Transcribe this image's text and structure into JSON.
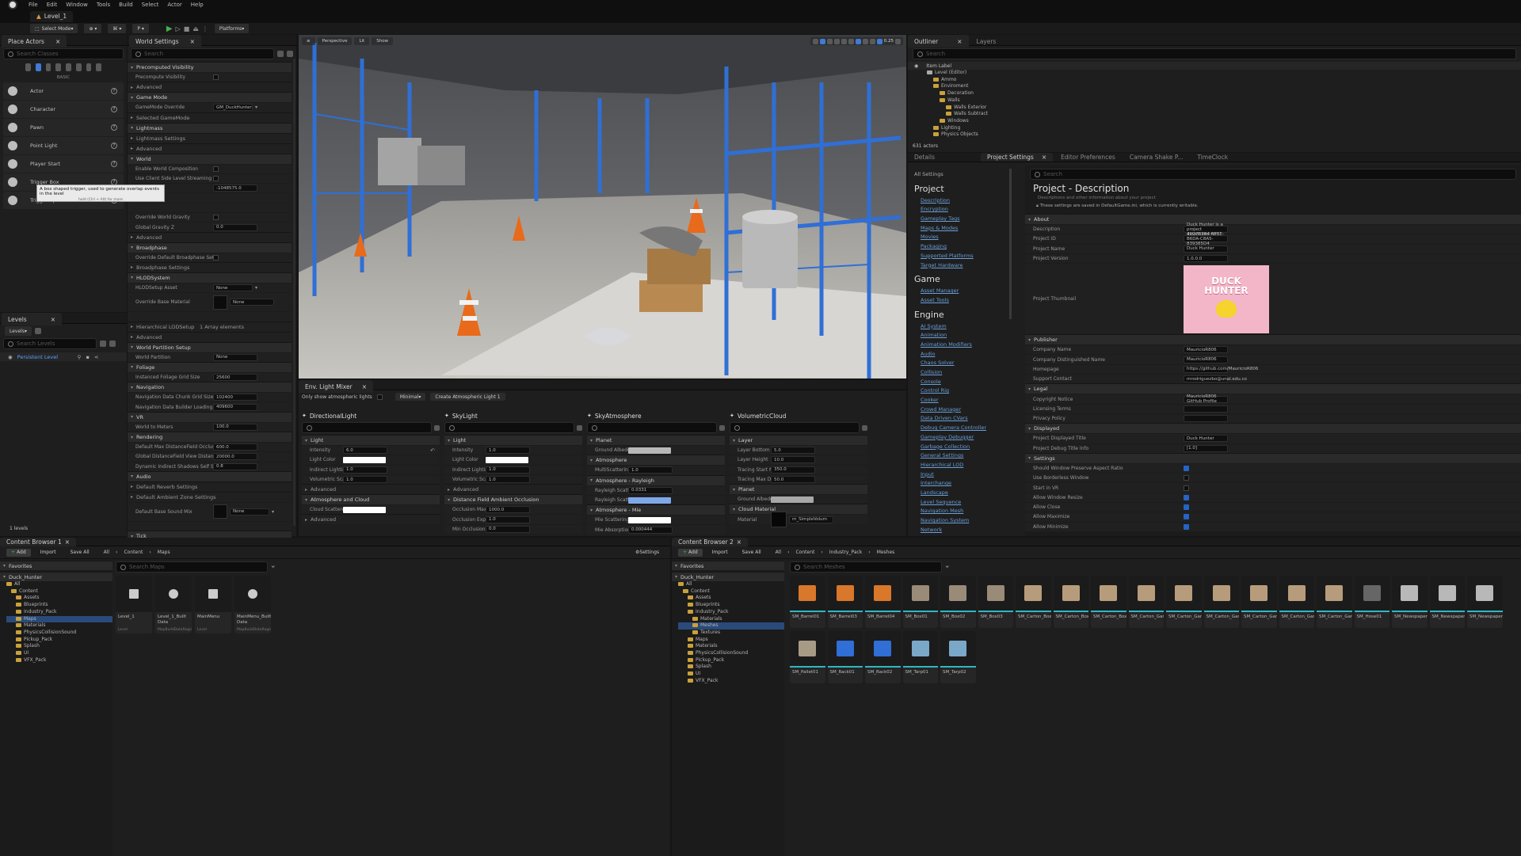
{
  "menu": {
    "items": [
      "File",
      "Edit",
      "Window",
      "Tools",
      "Build",
      "Select",
      "Actor",
      "Help"
    ],
    "level_tab": "Level_1"
  },
  "toolbar": {
    "select_mode": "Select Mode",
    "platforms": "Platforms"
  },
  "place_actors": {
    "tab": "Place Actors",
    "search_placeholder": "Search Classes",
    "category": "BASIC",
    "items": [
      "Actor",
      "Character",
      "Pawn",
      "Point Light",
      "Player Start",
      "Trigger Box",
      "Trigger Sphere"
    ],
    "tooltip": "A box shaped trigger, used to generate overlap events in the level",
    "tooltip_hint": "hold (Ctrl + Alt) for more"
  },
  "world_settings": {
    "tab": "World Settings",
    "search_placeholder": "Search",
    "rows": [
      {
        "t": "s",
        "l": "Precomputed Visibility"
      },
      {
        "t": "p",
        "l": "Precompute Visibility",
        "cb": false
      },
      {
        "t": "c",
        "l": "Advanced"
      },
      {
        "t": "s",
        "l": "Game Mode"
      },
      {
        "t": "p",
        "l": "GameMode Override",
        "val": "GM_DuckHunter",
        "dd": true
      },
      {
        "t": "c",
        "l": "Selected GameMode"
      },
      {
        "t": "s",
        "l": "Lightmass"
      },
      {
        "t": "c",
        "l": "Lightmass Settings"
      },
      {
        "t": "c",
        "l": "Advanced"
      },
      {
        "t": "s",
        "l": "World"
      },
      {
        "t": "p",
        "l": "Enable World Composition",
        "cb": false
      },
      {
        "t": "p",
        "l": "Use Client Side Level Streaming Volum",
        "cb": false
      },
      {
        "t": "p",
        "l": "Kill Z",
        "val": "-1048575.0"
      },
      {
        "t": "p",
        "l": ""
      },
      {
        "t": "p",
        "l": ""
      },
      {
        "t": "p",
        "l": "Override World Gravity",
        "cb": false
      },
      {
        "t": "p",
        "l": "Global Gravity Z",
        "val": "0.0"
      },
      {
        "t": "c",
        "l": "Advanced"
      },
      {
        "t": "s",
        "l": "Broadphase"
      },
      {
        "t": "p",
        "l": "Override Default Broadphase Settings",
        "cb": false
      },
      {
        "t": "c",
        "l": "Broadphase Settings"
      },
      {
        "t": "s",
        "l": "HLODSystem"
      },
      {
        "t": "p",
        "l": "HLODSetup Asset",
        "val": "None",
        "dd": true
      },
      {
        "t": "p",
        "l": "Override Base Material",
        "val": "None",
        "tall": true
      },
      {
        "t": "p",
        "l": ""
      },
      {
        "t": "c",
        "l": "Hierarchical LODSetup",
        "val": "1 Array elements"
      },
      {
        "t": "c",
        "l": "Advanced"
      },
      {
        "t": "s",
        "l": "World Partition Setup"
      },
      {
        "t": "p",
        "l": "World Partition",
        "val": "None"
      },
      {
        "t": "s",
        "l": "Foliage"
      },
      {
        "t": "p",
        "l": "Instanced Foliage Grid Size",
        "val": "25600"
      },
      {
        "t": "s",
        "l": "Navigation"
      },
      {
        "t": "p",
        "l": "Navigation Data Chunk Grid Size",
        "val": "102400"
      },
      {
        "t": "p",
        "l": "Navigation Data Builder Loading Grid Size",
        "val": "409600"
      },
      {
        "t": "s",
        "l": "VR"
      },
      {
        "t": "p",
        "l": "World to Meters",
        "val": "100.0"
      },
      {
        "t": "s",
        "l": "Rendering"
      },
      {
        "t": "p",
        "l": "Default Max DistanceField Occlusion D...",
        "val": "600.0"
      },
      {
        "t": "p",
        "l": "Global DistanceField View Distance",
        "val": "20000.0"
      },
      {
        "t": "p",
        "l": "Dynamic Indirect Shadows Self Shado...",
        "val": "0.8"
      },
      {
        "t": "s",
        "l": "Audio"
      },
      {
        "t": "c",
        "l": "Default Reverb Settings"
      },
      {
        "t": "c",
        "l": "Default Ambient Zone Settings"
      },
      {
        "t": "p",
        "l": "Default Base Sound Mix",
        "val": "None",
        "dd": true,
        "tall": true
      },
      {
        "t": "p",
        "l": ""
      },
      {
        "t": "s",
        "l": "Tick"
      },
      {
        "t": "p",
        "l": "Allow Tick Before Begin Play",
        "cb": true
      },
      {
        "t": "c",
        "l": "Advanced"
      },
      {
        "t": "c",
        "l": "AI"
      }
    ]
  },
  "levels": {
    "tab": "Levels",
    "dropdown": "Levels",
    "search_placeholder": "Search Levels",
    "persistent": "Persistent Level",
    "count": "1 levels"
  },
  "viewport": {
    "perspective": "Perspective",
    "lit": "Lit",
    "show": "Show",
    "speed": "0.25"
  },
  "env_mixer": {
    "tab": "Env. Light Mixer",
    "only_show": "Only show atmospheric lights",
    "mode": "Minimal",
    "create_btn": "Create Atmospheric Light 1",
    "cols": [
      {
        "title": "DirectionalLight",
        "rows": [
          {
            "t": "s",
            "l": "Light"
          },
          {
            "t": "p",
            "l": "Intensity",
            "val": "6.0",
            "rs": true
          },
          {
            "t": "p",
            "l": "Light Color",
            "col": "#ffffff"
          },
          {
            "t": "p",
            "l": "Indirect Lighting Intens...",
            "val": "1.0"
          },
          {
            "t": "p",
            "l": "Volumetric Scattering ...",
            "val": "1.0"
          },
          {
            "t": "c",
            "l": "Advanced"
          },
          {
            "t": "s",
            "l": "Atmosphere and Cloud"
          },
          {
            "t": "p",
            "l": "Cloud Scattered Lumi...",
            "col": "#ffffff"
          },
          {
            "t": "c",
            "l": "Advanced"
          }
        ]
      },
      {
        "title": "SkyLight",
        "rows": [
          {
            "t": "s",
            "l": "Light"
          },
          {
            "t": "p",
            "l": "Intensity",
            "val": "1.0"
          },
          {
            "t": "p",
            "l": "Light Color",
            "col": "#ffffff"
          },
          {
            "t": "p",
            "l": "Indirect Lighting Intens...",
            "val": "1.0"
          },
          {
            "t": "p",
            "l": "Volumetric Scattering In...",
            "val": "1.0"
          },
          {
            "t": "c",
            "l": "Advanced"
          },
          {
            "t": "s",
            "l": "Distance Field Ambient Occlusion"
          },
          {
            "t": "p",
            "l": "Occlusion Max Distance",
            "val": "1000.0"
          },
          {
            "t": "p",
            "l": "Occlusion Exponent",
            "val": "1.0"
          },
          {
            "t": "p",
            "l": "Min Occlusion",
            "val": "0.0"
          }
        ]
      },
      {
        "title": "SkyAtmosphere",
        "rows": [
          {
            "t": "s",
            "l": "Planet"
          },
          {
            "t": "p",
            "l": "Ground Albedo",
            "col": "#b8b8b8"
          },
          {
            "t": "s",
            "l": "Atmosphere"
          },
          {
            "t": "p",
            "l": "MultiScattering",
            "val": "1.0"
          },
          {
            "t": "s",
            "l": "Atmosphere - Rayleigh"
          },
          {
            "t": "p",
            "l": "Rayleigh Scattering Sca...",
            "val": "0.0331"
          },
          {
            "t": "p",
            "l": "Rayleigh Scattering",
            "col": "#7fa8e8"
          },
          {
            "t": "s",
            "l": "Atmosphere - Mie"
          },
          {
            "t": "p",
            "l": "Mie Scattering",
            "col": "#ffffff"
          },
          {
            "t": "p",
            "l": "Mie Absorption Scale",
            "val": "0.000444"
          }
        ]
      },
      {
        "title": "VolumetricCloud",
        "rows": [
          {
            "t": "s",
            "l": "Layer"
          },
          {
            "t": "p",
            "l": "Layer Bottom Altitude",
            "val": "5.0"
          },
          {
            "t": "p",
            "l": "Layer Height",
            "val": "10.0"
          },
          {
            "t": "p",
            "l": "Tracing Start Max Dis...",
            "val": "350.0"
          },
          {
            "t": "p",
            "l": "Tracing Max Distance",
            "val": "50.0"
          },
          {
            "t": "s",
            "l": "Planet"
          },
          {
            "t": "p",
            "l": "Ground Albedo",
            "col": "#a8a8a8"
          },
          {
            "t": "s",
            "l": "Cloud Material"
          },
          {
            "t": "p",
            "l": "Material",
            "val": "m_SimpleVolum",
            "mat": true
          }
        ]
      }
    ]
  },
  "outliner": {
    "tab": "Outliner",
    "tab2": "Layers",
    "search_placeholder": "Search",
    "header": "Item Label",
    "items": [
      {
        "l": "Level (Editor)",
        "d": 0
      },
      {
        "l": "Ammo",
        "d": 1
      },
      {
        "l": "Enviroment",
        "d": 1
      },
      {
        "l": "Decoration",
        "d": 2
      },
      {
        "l": "Walls",
        "d": 2
      },
      {
        "l": "Walls Exterior",
        "d": 3
      },
      {
        "l": "Walls Subtract",
        "d": 3
      },
      {
        "l": "Windows",
        "d": 2
      },
      {
        "l": "Lighting",
        "d": 1
      },
      {
        "l": "Physics Objects",
        "d": 1
      }
    ],
    "count": "631 actors"
  },
  "details_tabs": [
    "Details",
    "Project Settings",
    "Editor Preferences",
    "Camera Shake P...",
    "TimeClock"
  ],
  "settings_nav": {
    "all": "All Settings",
    "groups": [
      {
        "h": "Project",
        "items": [
          "Description",
          "Encryption",
          "Gameplay Tags",
          "Maps & Modes",
          "Movies",
          "Packaging",
          "Supported Platforms",
          "Target Hardware"
        ]
      },
      {
        "h": "Game",
        "items": [
          "Asset Manager",
          "Asset Tools"
        ]
      },
      {
        "h": "Engine",
        "items": [
          "AI System",
          "Animation",
          "Animation Modifiers",
          "Audio",
          "Chaos Solver",
          "Collision",
          "Console",
          "Control Rig",
          "Cooker",
          "Crowd Manager",
          "Data Driven CVars",
          "Debug Camera Controller",
          "Gameplay Debugger",
          "Garbage Collection",
          "General Settings",
          "Hierarchical LOD",
          "Input",
          "Interchange",
          "Landscape",
          "Level Sequence",
          "Navigation Mesh",
          "Navigation System",
          "Network"
        ]
      }
    ]
  },
  "project_desc": {
    "search_placeholder": "Search",
    "title": "Project - Description",
    "subtitle": "Descriptions and other information about your project",
    "note": "These settings are saved in DefaultGame.ini, which is currently writable.",
    "rows": [
      {
        "t": "s",
        "l": "About"
      },
      {
        "t": "p",
        "l": "Description",
        "val": "Duck Hunter is a project developed for"
      },
      {
        "t": "p",
        "l": "Project ID",
        "val": "49D7E7B4-4FBE-B6DA-C8A5-839385D4"
      },
      {
        "t": "p",
        "l": "Project Name",
        "val": "Duck Hunter"
      },
      {
        "t": "p",
        "l": "Project Version",
        "val": "1.0.0.0"
      },
      {
        "t": "thumb",
        "l": "Project Thumbnail"
      },
      {
        "t": "s",
        "l": "Publisher"
      },
      {
        "t": "p",
        "l": "Company Name",
        "val": "MauricioR806"
      },
      {
        "t": "p",
        "l": "Company Distinguished Name",
        "val": "MauricioR806"
      },
      {
        "t": "p",
        "l": "Homepage",
        "val": "https://github.com/MauricioR806"
      },
      {
        "t": "p",
        "l": "Support Contact",
        "val": "mrodriguezbo@unal.edu.co"
      },
      {
        "t": "s",
        "l": "Legal"
      },
      {
        "t": "p",
        "l": "Copyright Notice",
        "val": "MauricioR806 GitHub Profile"
      },
      {
        "t": "p",
        "l": "Licensing Terms",
        "val": ""
      },
      {
        "t": "p",
        "l": "Privacy Policy",
        "val": ""
      },
      {
        "t": "s",
        "l": "Displayed"
      },
      {
        "t": "p",
        "l": "Project Displayed Title",
        "val": "Duck Hunter"
      },
      {
        "t": "p",
        "l": "Project Debug Title Info",
        "val": "[1.0]"
      },
      {
        "t": "s",
        "l": "Settings"
      },
      {
        "t": "p",
        "l": "Should Window Preserve Aspect Ratio",
        "cb": true
      },
      {
        "t": "p",
        "l": "Use Borderless Window",
        "cb": false
      },
      {
        "t": "p",
        "l": "Start in VR",
        "cb": false
      },
      {
        "t": "p",
        "l": "Allow Window Resize",
        "cb": true
      },
      {
        "t": "p",
        "l": "Allow Close",
        "cb": true
      },
      {
        "t": "p",
        "l": "Allow Maximize",
        "cb": true
      },
      {
        "t": "p",
        "l": "Allow Minimize",
        "cb": true
      }
    ],
    "thumb_text": "DUCK HUNTER"
  },
  "cb1": {
    "tab": "Content Browser 1",
    "add": "Add",
    "import": "Import",
    "save_all": "Save All",
    "crumbs": [
      "All",
      "Content",
      "Maps"
    ],
    "settings": "Settings",
    "favorites": "Favorites",
    "project": "Duck_Hunter",
    "search_placeholder": "Search Maps",
    "tree": [
      {
        "l": "All",
        "d": 0
      },
      {
        "l": "Content",
        "d": 1
      },
      {
        "l": "Assets",
        "d": 2
      },
      {
        "l": "Blueprints",
        "d": 2
      },
      {
        "l": "Industry_Pack",
        "d": 2
      },
      {
        "l": "Maps",
        "d": 2,
        "sel": true
      },
      {
        "l": "Materials",
        "d": 2
      },
      {
        "l": "PhysicsCollisionSound",
        "d": 2
      },
      {
        "l": "Pickup_Pack",
        "d": 2
      },
      {
        "l": "Splash",
        "d": 2
      },
      {
        "l": "UI",
        "d": 2
      },
      {
        "l": "VFX_Pack",
        "d": 2
      }
    ],
    "assets": [
      {
        "n": "Level_1",
        "t": "Level"
      },
      {
        "n": "Level_1_Built Data",
        "t": "MapBuildDataRegistry"
      },
      {
        "n": "MainMenu",
        "t": "Level"
      },
      {
        "n": "MainMenu_Built Data",
        "t": "MapBuildDataRegistry"
      }
    ]
  },
  "cb2": {
    "tab": "Content Browser 2",
    "add": "Add",
    "import": "Import",
    "save_all": "Save All",
    "crumbs": [
      "All",
      "Content",
      "Industry_Pack",
      "Meshes"
    ],
    "favorites": "Favorites",
    "project": "Duck_Hunter",
    "search_placeholder": "Search Meshes",
    "tree": [
      {
        "l": "All",
        "d": 0
      },
      {
        "l": "Content",
        "d": 1
      },
      {
        "l": "Assets",
        "d": 2
      },
      {
        "l": "Blueprints",
        "d": 2
      },
      {
        "l": "Industry_Pack",
        "d": 2
      },
      {
        "l": "Materials",
        "d": 3
      },
      {
        "l": "Meshes",
        "d": 3,
        "sel": true
      },
      {
        "l": "Textures",
        "d": 3
      },
      {
        "l": "Maps",
        "d": 2
      },
      {
        "l": "Materials",
        "d": 2
      },
      {
        "l": "PhysicsCollisionSound",
        "d": 2
      },
      {
        "l": "Pickup_Pack",
        "d": 2
      },
      {
        "l": "Splash",
        "d": 2
      },
      {
        "l": "UI",
        "d": 2
      },
      {
        "l": "VFX_Pack",
        "d": 2
      }
    ],
    "assets": [
      "SM_Barrel01",
      "SM_Barrel03",
      "SM_Barrel04",
      "SM_Box01",
      "SM_Box02",
      "SM_Box03",
      "SM_Carton_Box01",
      "SM_Carton_Box02",
      "SM_Carton_Box03",
      "SM_Carton_Garbage01",
      "SM_Carton_Garbage02",
      "SM_Carton_Garbage03",
      "SM_Carton_Garbage07",
      "SM_Carton_Garbage08",
      "SM_Carton_Garbage09",
      "SM_Hose01",
      "SM_Newspaper01",
      "SM_Newspaper02",
      "SM_Newspaper03",
      "SM_Pallet01",
      "SM_Rack01",
      "SM_Rack02",
      "SM_Tarp01",
      "SM_Tarp02"
    ]
  }
}
